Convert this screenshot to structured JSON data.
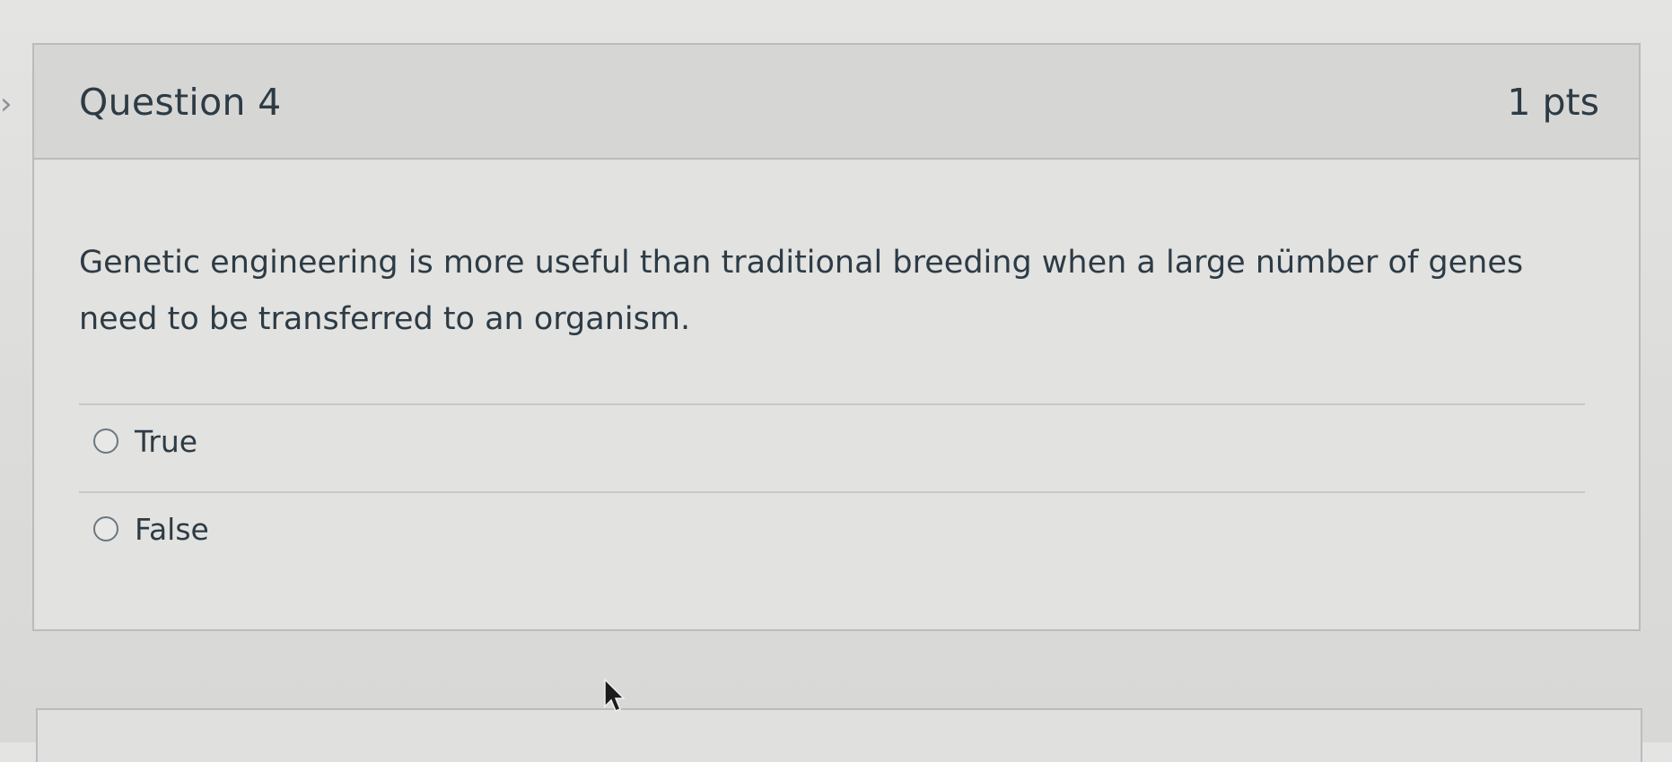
{
  "question": {
    "title": "Question 4",
    "points": "1 pts",
    "text": "Genetic engineering is more useful than traditional breeding when a large nümber of genes need to be transferred to an organism.",
    "answers": [
      {
        "label": "True",
        "selected": false
      },
      {
        "label": "False",
        "selected": false
      }
    ]
  },
  "icons": {
    "side_arrow": "chevron-right-icon",
    "radio": "radio-button-icon",
    "cursor": "mouse-pointer-icon"
  },
  "colors": {
    "text": "#2d3b45",
    "header_bg": "#d6d6d4",
    "border": "#b9bcbe"
  }
}
